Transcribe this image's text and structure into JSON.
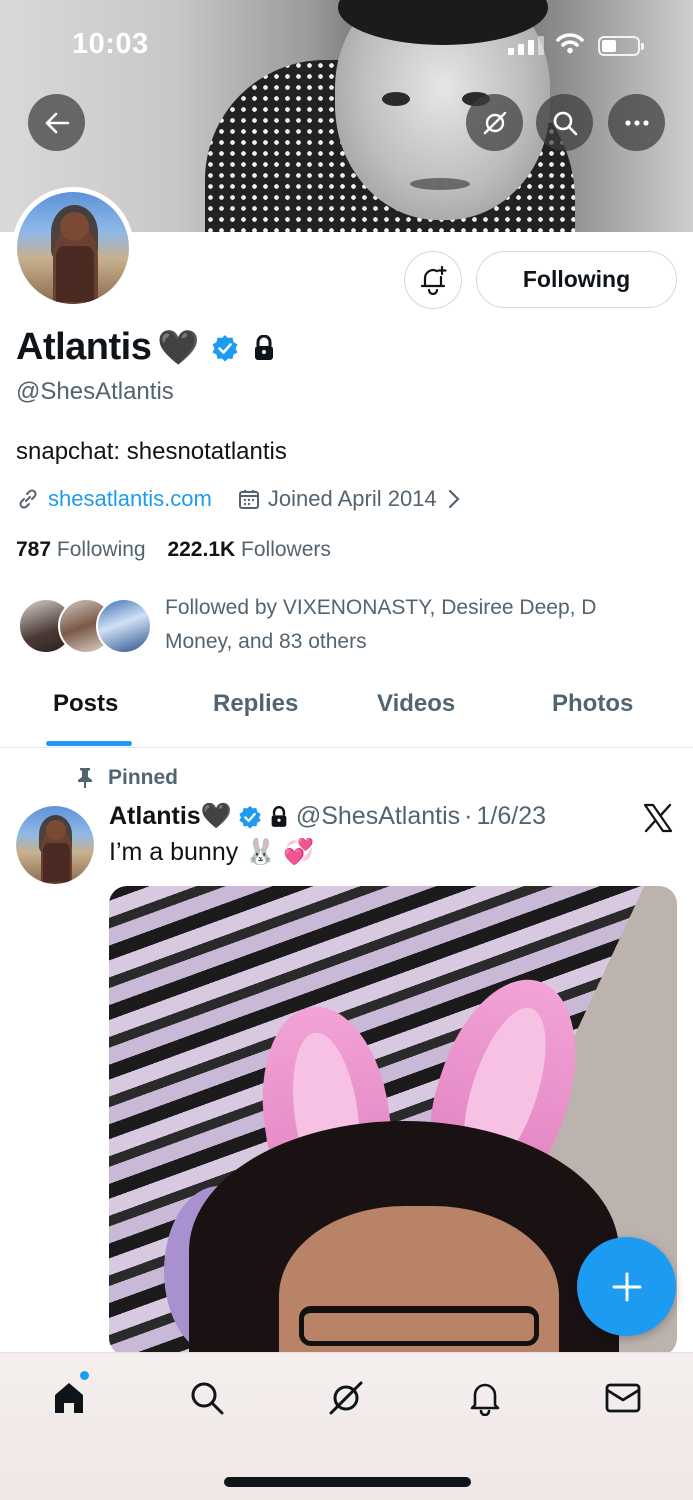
{
  "status_bar": {
    "time": "10:03"
  },
  "profile": {
    "name": "Atlantis",
    "name_emoji": "🖤",
    "handle": "@ShesAtlantis",
    "bio": "snapchat: shesnotatlantis",
    "website": "shesatlantis.com",
    "joined": "Joined April 2014",
    "following_count": "787",
    "following_label": "Following",
    "followers_count": "222.1K",
    "followers_label": "Followers",
    "followed_by": "Followed by VIXENONASTY, Desiree Deep, D Money, and 83 others",
    "follow_button_label": "Following"
  },
  "tabs": [
    {
      "label": "Posts",
      "active": true
    },
    {
      "label": "Replies",
      "active": false
    },
    {
      "label": "Videos",
      "active": false
    },
    {
      "label": "Photos",
      "active": false
    }
  ],
  "pinned_post": {
    "pinned_label": "Pinned",
    "author_name": "Atlantis",
    "author_emoji": "🖤",
    "author_handle": "@ShesAtlantis",
    "separator": "·",
    "date": "1/6/23",
    "text": "I’m a bunny 🐰 💞"
  },
  "colors": {
    "accent": "#1d9bf0",
    "text_primary": "#0f1419",
    "text_secondary": "#536471"
  },
  "icons": {
    "back": "arrow-left-icon",
    "grok": "grok-icon",
    "search": "search-icon",
    "more": "more-icon",
    "bell": "bell-plus-icon",
    "verified": "verified-badge-icon",
    "lock": "lock-icon",
    "link": "link-icon",
    "calendar": "calendar-icon",
    "pin": "pin-icon",
    "x": "x-logo-icon",
    "compose": "plus-icon",
    "nav": [
      "home-icon",
      "search-icon",
      "grok-icon",
      "bell-icon",
      "mail-icon"
    ]
  }
}
